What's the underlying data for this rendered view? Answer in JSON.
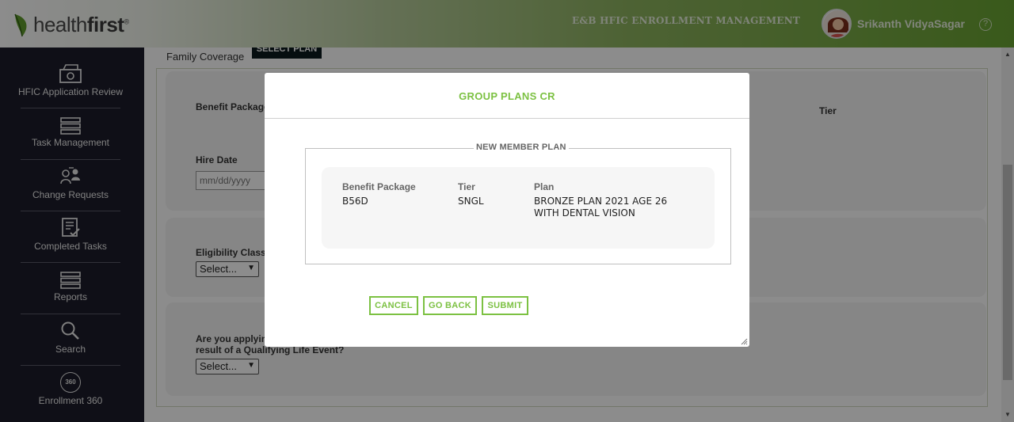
{
  "header": {
    "logo_text_regular": "health",
    "logo_text_bold": "first",
    "logo_mark": "®",
    "title": "E&B HFIC ENROLLMENT MANAGEMENT",
    "user_name": "Srikanth VidyaSagar",
    "help_glyph": "?"
  },
  "sidebar": {
    "items": [
      {
        "label": "HFIC Application Review",
        "icon": "application-review-icon"
      },
      {
        "label": "Task Management",
        "icon": "server-stack-icon"
      },
      {
        "label": "Change Requests",
        "icon": "users-exchange-icon"
      },
      {
        "label": "Completed Tasks",
        "icon": "checklist-icon"
      },
      {
        "label": "Reports",
        "icon": "server-stack-icon"
      },
      {
        "label": "Search",
        "icon": "search-icon"
      },
      {
        "label": "Enrollment 360",
        "icon": "enrollment-360-icon"
      }
    ],
    "badge_360": "360"
  },
  "main": {
    "family_coverage_label": "Family Coverage",
    "select_plan_label": "SELECT PLAN",
    "benefit_package_label": "Benefit Package",
    "tier_label": "Tier",
    "hire_date_label": "Hire Date",
    "hire_date_placeholder": "mm/dd/yyyy",
    "eligibility_class_label": "Eligibility Class",
    "eligibility_select_value": "Select...",
    "qle_question_line1": "Are you applying",
    "qle_question_line2": "result of a Qualifying Life Event?",
    "qle_select_value": "Select..."
  },
  "modal": {
    "title": "GROUP PLANS CR",
    "fieldset_legend": "NEW MEMBER PLAN",
    "columns": {
      "benefit_package_label": "Benefit Package",
      "benefit_package_value": "B56D",
      "tier_label": "Tier",
      "tier_value": "SNGL",
      "plan_label": "Plan",
      "plan_value": "BRONZE PLAN 2021 AGE 26 WITH DENTAL VISION"
    },
    "buttons": {
      "cancel": "CANCEL",
      "go_back": "GO BACK",
      "submit": "SUBMIT"
    }
  },
  "colors": {
    "accent_green": "#7cc142",
    "sidebar_bg": "#1c1c2a",
    "overlay": "rgba(0,0,0,0.45)"
  }
}
